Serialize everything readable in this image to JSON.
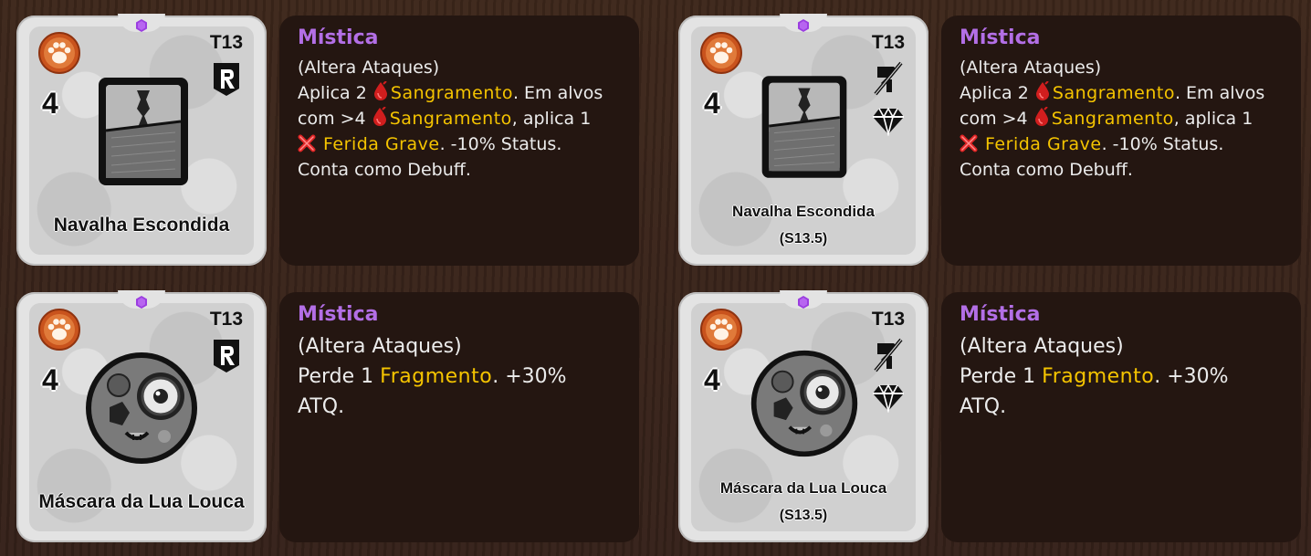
{
  "items": [
    {
      "tier": "T13",
      "cost": "4",
      "name": "Navalha Escondida",
      "rarity": "Mística",
      "tag": "(Altera Ataques)",
      "desc": {
        "p1": "Aplica 2",
        "kw1": "Sangramento",
        "p2": ". Em alvos",
        "p3": "com >4",
        "kw2": "Sangramento",
        "p4": ", aplica 1",
        "kw3": "Ferida Grave",
        "p5": ". -10% Status.",
        "p6": "Conta como Debuff."
      }
    },
    {
      "tier": "T13",
      "cost": "4",
      "name": "Navalha Escondida",
      "season": "(S13.5)",
      "rarity": "Mística",
      "tag": "(Altera Ataques)",
      "desc": {
        "p1": "Aplica 2",
        "kw1": "Sangramento",
        "p2": ". Em alvos",
        "p3": "com >4",
        "kw2": "Sangramento",
        "p4": ", aplica 1",
        "kw3": "Ferida Grave",
        "p5": ". -10% Status.",
        "p6": "Conta como Debuff."
      }
    },
    {
      "tier": "T13",
      "cost": "4",
      "name": "Máscara da Lua Louca",
      "rarity": "Mística",
      "tag": "(Altera Ataques)",
      "desc": {
        "p1": "Perde 1",
        "kw1": "Fragmento",
        "p2": ". +30%",
        "p3": "ATQ."
      }
    },
    {
      "tier": "T13",
      "cost": "4",
      "name": "Máscara da Lua Louca",
      "season": "(S13.5)",
      "rarity": "Mística",
      "tag": "(Altera Ataques)",
      "desc": {
        "p1": "Perde 1",
        "kw1": "Fragmento",
        "p2": ". +30%",
        "p3": "ATQ."
      }
    }
  ],
  "icons": {
    "class": "paw-icon",
    "gem": "purple-gem-icon",
    "ranged": "r-badge-icon",
    "no_melee": "crossed-weapon-icon",
    "diamond": "diamond-icon",
    "bleed": "blood-drop-icon",
    "wound": "red-x-wound-icon"
  },
  "colors": {
    "rarity": "#b36fe6",
    "keyword": "#f5c400",
    "panel": "#241611",
    "card": "#e3e3e3"
  }
}
